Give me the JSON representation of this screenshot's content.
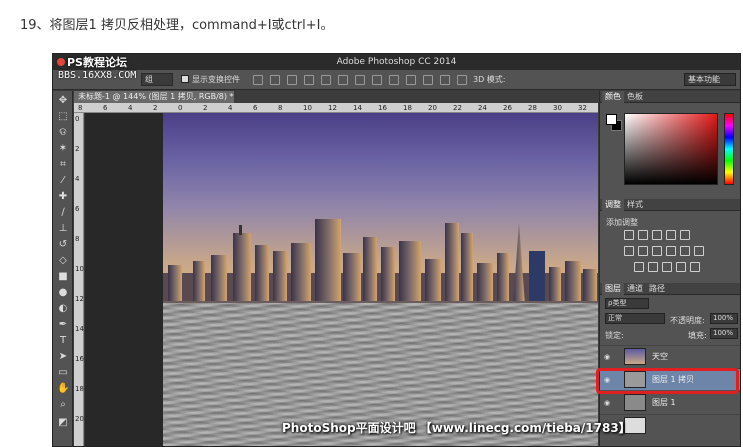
{
  "instruction": {
    "text": "19、将图层1 拷贝反相处理，command+I或ctrl+I。"
  },
  "window": {
    "title": "Adobe Photoshop CC 2014",
    "logo_text": "PS教程论坛",
    "bbs_text": "BBS.16XX8.COM"
  },
  "options_bar": {
    "select_value": "组",
    "show_transform_label": "显示变换控件",
    "mode_3d_label": "3D 模式:",
    "workspace_value": "基本功能"
  },
  "document": {
    "tab_label": "未标题-1 @ 144% (图层 1 拷贝, RGB/8) *",
    "ruler_top_numbers": [
      "8",
      "6",
      "4",
      "2",
      "0",
      "2",
      "4",
      "6",
      "8",
      "10",
      "12",
      "14",
      "16",
      "18",
      "20",
      "22",
      "24",
      "26",
      "28",
      "30",
      "32"
    ],
    "ruler_left_numbers": [
      "0",
      "2",
      "4",
      "6",
      "8",
      "10",
      "12",
      "14",
      "16",
      "18",
      "20"
    ]
  },
  "panels": {
    "color_tabs": [
      "颜色",
      "色板"
    ],
    "adjust_tabs": [
      "调整",
      "样式"
    ],
    "adjust_label": "添加调整",
    "layer_tabs": [
      "图层",
      "通道",
      "路径"
    ],
    "kind_select": "ρ类型",
    "blend_mode": "正常",
    "opacity_label": "不透明度:",
    "opacity_value": "100%",
    "lock_label": "锁定:",
    "fill_label": "填充:",
    "fill_value": "100%"
  },
  "layers": [
    {
      "name": "天空",
      "selected": false
    },
    {
      "name": "图层 1 拷贝",
      "selected": true
    },
    {
      "name": "图层 1",
      "selected": false
    }
  ],
  "bottom_watermark": {
    "text": "PhotoShop平面设计吧 【www.linecg.com/tieba/1783】"
  },
  "colors": {
    "highlight": "#e02020",
    "selected_layer": "#6d85a8",
    "panel_bg": "#535353"
  }
}
